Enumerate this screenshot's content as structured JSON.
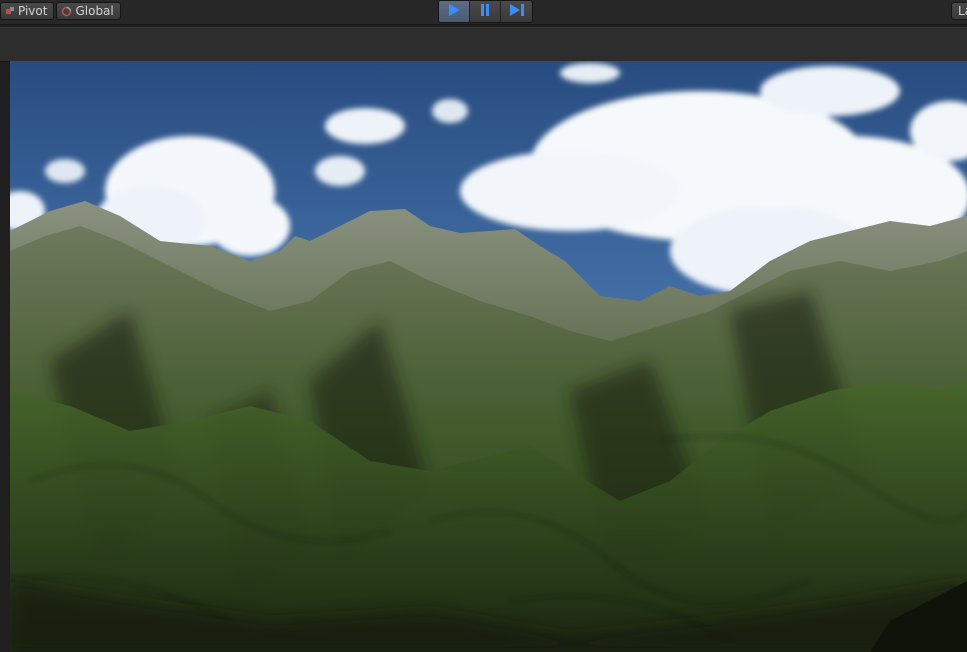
{
  "toolbar": {
    "pivot_label": "Pivot",
    "global_label": "Global",
    "layers_label": "La",
    "play_icon": "play-icon",
    "pause_icon": "pause-icon",
    "step_icon": "step-icon",
    "accent": "#3d8df5"
  },
  "scene": {
    "sky_top": "#2a4f85",
    "sky_bottom": "#6f9ac6",
    "cloud": "#ffffff",
    "mountain_light": "#6f7a66",
    "mountain_mid": "#3f5a2a",
    "mountain_dark": "#1b2612"
  }
}
